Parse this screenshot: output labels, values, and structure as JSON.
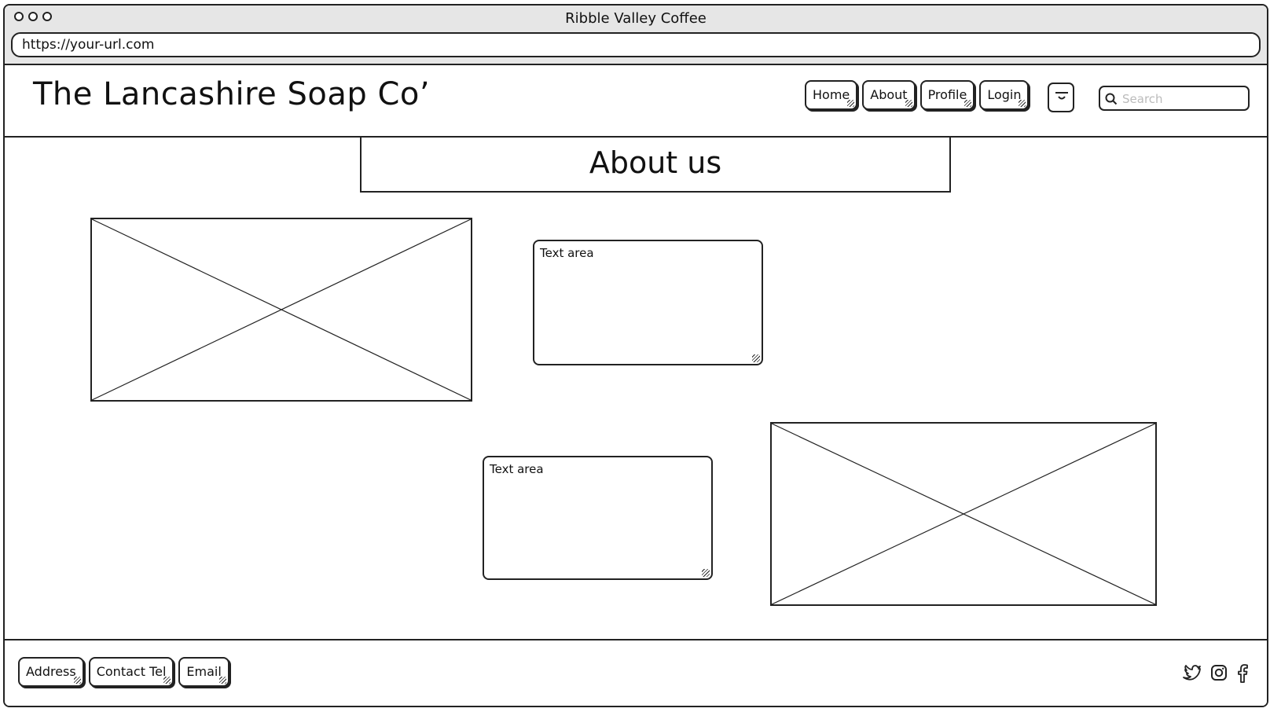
{
  "window": {
    "title": "Ribble Valley Coffee",
    "url": "https://your-url.com"
  },
  "header": {
    "brand": "The Lancashire Soap Co’",
    "nav": [
      "Home",
      "About",
      "Profile",
      "Login"
    ],
    "cart_icon": "shopping-bag-icon",
    "search": {
      "placeholder": "Search",
      "icon": "search-icon"
    }
  },
  "main": {
    "title": "About us",
    "sections": [
      {
        "image": "image-placeholder",
        "text": "Text area"
      },
      {
        "image": "image-placeholder",
        "text": "Text area"
      }
    ]
  },
  "footer": {
    "links": [
      "Address",
      "Contact Tel",
      "Email"
    ],
    "social": [
      "twitter-icon",
      "instagram-icon",
      "facebook-icon"
    ]
  }
}
